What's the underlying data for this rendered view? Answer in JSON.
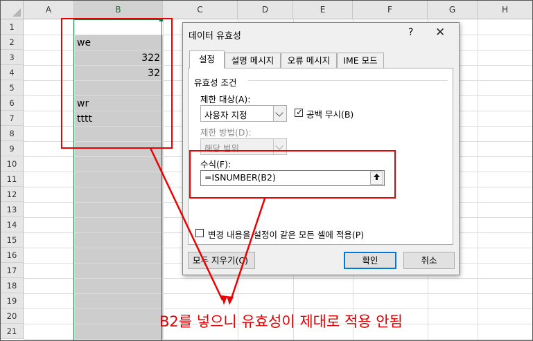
{
  "sheet": {
    "columns": [
      "A",
      "B",
      "C",
      "D",
      "E",
      "F",
      "G",
      "H"
    ],
    "rows": [
      "1",
      "2",
      "3",
      "4",
      "5",
      "6",
      "7",
      "8",
      "9",
      "10",
      "11",
      "12",
      "13",
      "14",
      "15",
      "16",
      "17",
      "18",
      "19",
      "20",
      "21"
    ],
    "cells": {
      "b2": "we",
      "b3": "322",
      "b4": "32",
      "b6": "wr",
      "b7": "tttt"
    }
  },
  "dialog": {
    "title": "데이터 유효성",
    "help": "?",
    "tabs": [
      "설정",
      "설명 메시지",
      "오류 메시지",
      "IME 모드"
    ],
    "group_label": "유효성 조건",
    "allow_label": "제한 대상(A):",
    "allow_value": "사용자 지정",
    "ignore_blank_label": "공백 무시(B)",
    "ignore_blank_checked": "✓",
    "data_label": "제한 방법(D):",
    "data_value": "해당 범위",
    "formula_label": "수식(F):",
    "formula_value": "=ISNUMBER(B2)",
    "apply_all_label": "변경 내용을 설정이 같은 모든 셀에 적용(P)",
    "clear_all": "모두 지우기(C)",
    "ok": "확인",
    "cancel": "취소"
  },
  "annotation": {
    "note": "B2를 넣으니 유효성이 제대로 적용 안됨",
    "color": "#dd0000"
  },
  "colors": {
    "selection": "#217346",
    "selected_fill": "#cdcdcd",
    "dialog_bg": "#f0f0f0"
  }
}
